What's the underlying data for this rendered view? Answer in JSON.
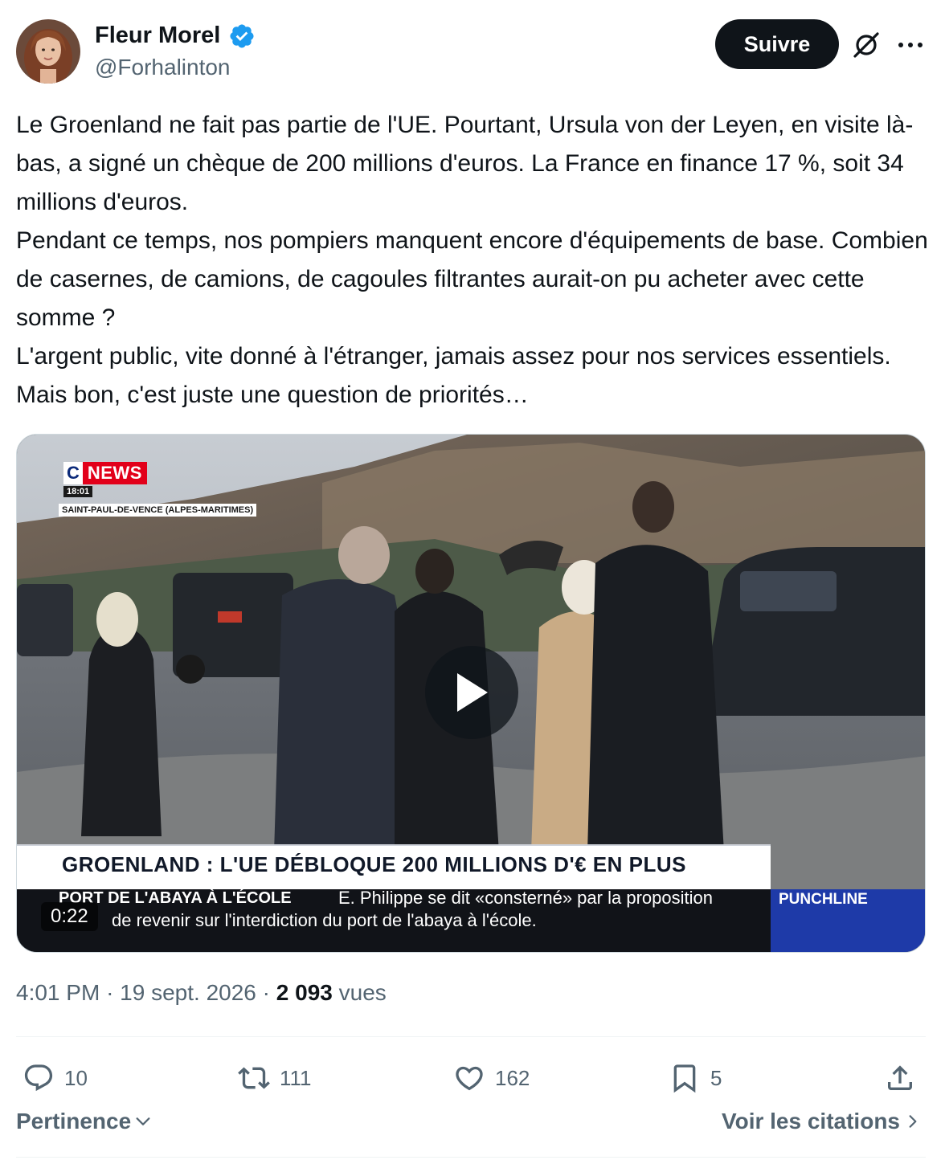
{
  "author": {
    "name": "Fleur Morel",
    "handle": "@Forhalinton",
    "verified": true
  },
  "header": {
    "follow_label": "Suivre"
  },
  "tweet": {
    "paragraphs": [
      "Le Groenland ne fait pas partie de l'UE. Pourtant, Ursula von der Leyen, en visite là-bas, a signé un chèque de 200 millions d'euros. La France en finance 17 %, soit 34 millions d'euros.",
      "Pendant ce temps, nos pompiers manquent encore d'équipements de base. Combien de casernes, de camions, de cagoules filtrantes aurait-on pu acheter avec cette somme ?",
      "L'argent public, vite donné à l'étranger, jamais assez pour nos services essentiels. Mais bon, c'est juste une question de priorités…"
    ]
  },
  "video": {
    "duration": "0:22",
    "channel_c": "C",
    "channel_news": "NEWS",
    "clock": "18:01",
    "location": "SAINT-PAUL-DE-VENCE (ALPES-MARITIMES)",
    "headline": "GROENLAND : L'UE DÉBLOQUE 200 MILLIONS D'€ EN PLUS",
    "ticker_label": "PORT DE L'ABAYA À L'ÉCOLE",
    "ticker_line1": "E. Philippe se dit «consterné» par la proposition",
    "ticker_line2": "de revenir sur l'interdiction du port de l'abaya à l'école.",
    "program": "PUNCHLINE"
  },
  "meta": {
    "time": "4:01 PM",
    "separator": "·",
    "date": "19 sept. 2026",
    "views_count": "2 093",
    "views_label": "vues"
  },
  "actions": {
    "replies": "10",
    "reposts": "111",
    "likes": "162",
    "bookmarks": "5"
  },
  "footer": {
    "sort_label": "Pertinence",
    "quotes_label": "Voir les citations"
  },
  "colors": {
    "text": "#0f1419",
    "secondary": "#536471",
    "verified": "#1d9bf0",
    "follow_bg": "#0f1419",
    "cnews_red": "#e2001a",
    "punchline_blue": "#1e3aa8"
  }
}
